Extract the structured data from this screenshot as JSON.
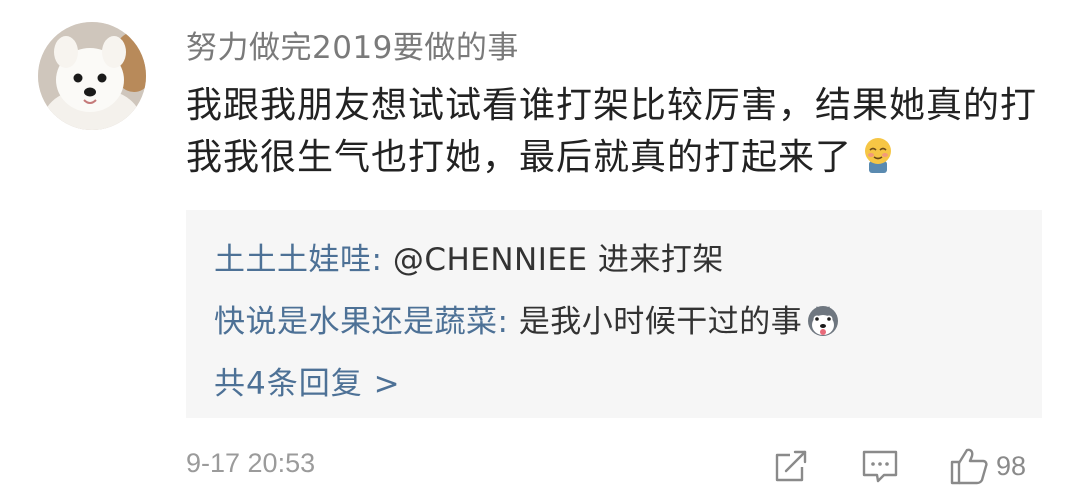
{
  "comment": {
    "username": "努力做完2019要做的事",
    "text": "我跟我朋友想试试看谁打架比较厉害，结果她真的打我我很生气也打她，最后就真的打起来了",
    "emoji": "blush-emoji"
  },
  "replies": [
    {
      "name": "土土土娃哇:",
      "content": "@CHENNIEE 进来打架"
    },
    {
      "name": "快说是水果还是蔬菜:",
      "content": "是我小时候干过的事",
      "emoji": "husky-emoji"
    }
  ],
  "more_replies": "共4条回复 >",
  "footer": {
    "timestamp": "9-17 20:53",
    "like_count": "98",
    "icons": [
      "share-icon",
      "comment-icon",
      "like-icon"
    ]
  },
  "colors": {
    "link_blue": "#4d7196",
    "text_dark": "#222222",
    "meta_gray": "#9b9b9b",
    "reply_bg": "#f6f6f6"
  }
}
